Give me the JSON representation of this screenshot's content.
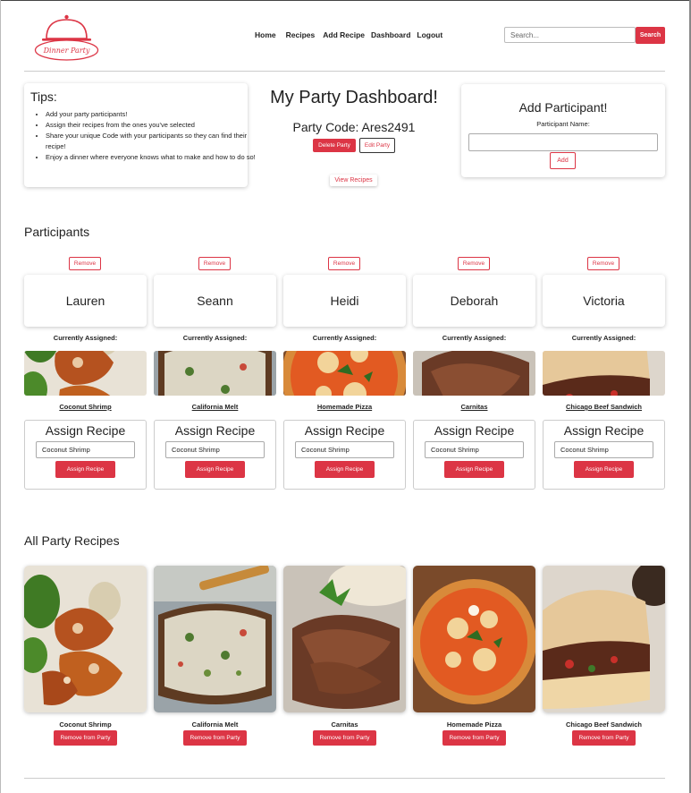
{
  "brand": {
    "logo_text": "Dinner Party",
    "accent": "#dc3545"
  },
  "nav": {
    "items": [
      "Home",
      "Recipes",
      "Add Recipe",
      "Dashboard",
      "Logout"
    ]
  },
  "search": {
    "placeholder": "Search...",
    "button": "Search"
  },
  "tips": {
    "title": "Tips:",
    "items": [
      "Add your party participants!",
      "Assign their recipes from the ones you've selected",
      "Share your unique Code with your participants so they can find their recipe!",
      "Enjoy a dinner where everyone knows what to make and how to do so!"
    ]
  },
  "dashboard": {
    "title": "My Party Dashboard!",
    "party_code": "Party Code: Ares2491",
    "delete_label": "Delete Party",
    "edit_label": "Edit Party",
    "view_recipes_label": "View Recipes"
  },
  "add_participant": {
    "title": "Add Participant!",
    "field_label": "Participant Name:",
    "add_label": "Add"
  },
  "participants_section": {
    "title": "Participants",
    "remove_label": "Remove",
    "currently_assigned_label": "Currently Assigned:",
    "assign_title": "Assign Recipe",
    "assign_button": "Assign Recipe",
    "items": [
      {
        "name": "Lauren",
        "assigned": "Coconut Shrimp",
        "select_value": "Coconut Shrimp",
        "image": "coconut-shrimp"
      },
      {
        "name": "Seann",
        "assigned": "California Melt",
        "select_value": "Coconut Shrimp",
        "image": "california-melt"
      },
      {
        "name": "Heidi",
        "assigned": "Homemade Pizza",
        "select_value": "Coconut Shrimp",
        "image": "homemade-pizza"
      },
      {
        "name": "Deborah",
        "assigned": "Carnitas",
        "select_value": "Coconut Shrimp",
        "image": "carnitas"
      },
      {
        "name": "Victoria",
        "assigned": "Chicago Beef Sandwich",
        "select_value": "Coconut Shrimp",
        "image": "chicago-beef-sandwich"
      }
    ]
  },
  "party_recipes": {
    "title": "All Party Recipes",
    "remove_label": "Remove from Party",
    "items": [
      {
        "name": "Coconut Shrimp",
        "image": "coconut-shrimp"
      },
      {
        "name": "California Melt",
        "image": "california-melt"
      },
      {
        "name": "Carnitas",
        "image": "carnitas"
      },
      {
        "name": "Homemade Pizza",
        "image": "homemade-pizza"
      },
      {
        "name": "Chicago Beef Sandwich",
        "image": "chicago-beef-sandwich"
      }
    ]
  }
}
